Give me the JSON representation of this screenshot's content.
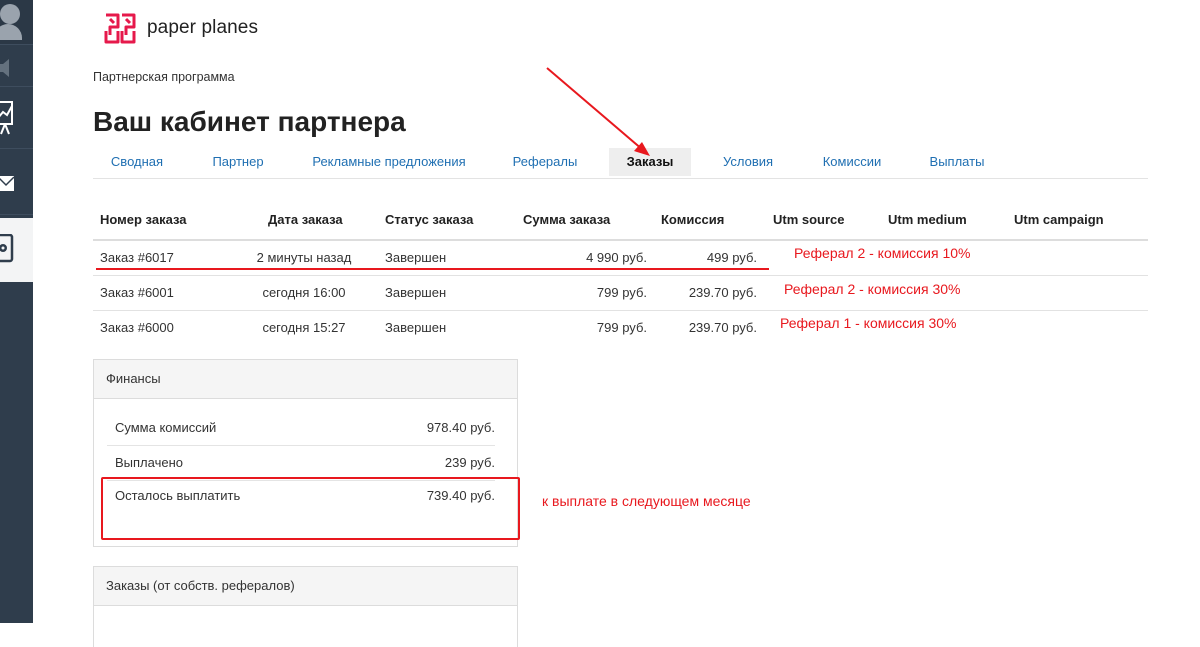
{
  "brand": {
    "name": "paper planes",
    "logo_color": "#e6194b"
  },
  "breadcrumb": "Партнерская программа",
  "page_title": "Ваш кабинет партнера",
  "tabs": [
    {
      "label": "Сводная",
      "active": false
    },
    {
      "label": "Партнер",
      "active": false
    },
    {
      "label": "Рекламные предложения",
      "active": false
    },
    {
      "label": "Рефералы",
      "active": false
    },
    {
      "label": "Заказы",
      "active": true
    },
    {
      "label": "Условия",
      "active": false
    },
    {
      "label": "Комиссии",
      "active": false
    },
    {
      "label": "Выплаты",
      "active": false
    }
  ],
  "orders": {
    "columns": [
      "Номер заказа",
      "Дата заказа",
      "Статус заказа",
      "Сумма заказа",
      "Комиссия",
      "Utm source",
      "Utm medium",
      "Utm campaign"
    ],
    "rows": [
      {
        "number": "Заказ #6017",
        "date": "2 минуты назад",
        "status": "Завершен",
        "sum": "4 990 руб.",
        "commission": "499 руб."
      },
      {
        "number": "Заказ #6001",
        "date": "сегодня 16:00",
        "status": "Завершен",
        "sum": "799 руб.",
        "commission": "239.70 руб."
      },
      {
        "number": "Заказ #6000",
        "date": "сегодня 15:27",
        "status": "Завершен",
        "sum": "799 руб.",
        "commission": "239.70 руб."
      }
    ]
  },
  "finance": {
    "title": "Финансы",
    "rows": [
      {
        "label": "Сумма комиссий",
        "value": "978.40 руб."
      },
      {
        "label": "Выплачено",
        "value": "239 руб."
      },
      {
        "label": "Осталось выплатить",
        "value": "739.40 руб."
      }
    ]
  },
  "referral_orders": {
    "title": "Заказы (от собств. рефералов)"
  },
  "annotations": {
    "row_notes": [
      "Реферал 2 - комиссия 10%",
      "Реферал 2 - комиссия 30%",
      "Реферал 1 - комиссия 30%"
    ],
    "payout_note": "к выплате в следующем месяце",
    "color": "#e8181e"
  },
  "colors": {
    "sidebar": "#2f3d4c",
    "link": "#1f6fb2",
    "accent": "#e6194b"
  }
}
